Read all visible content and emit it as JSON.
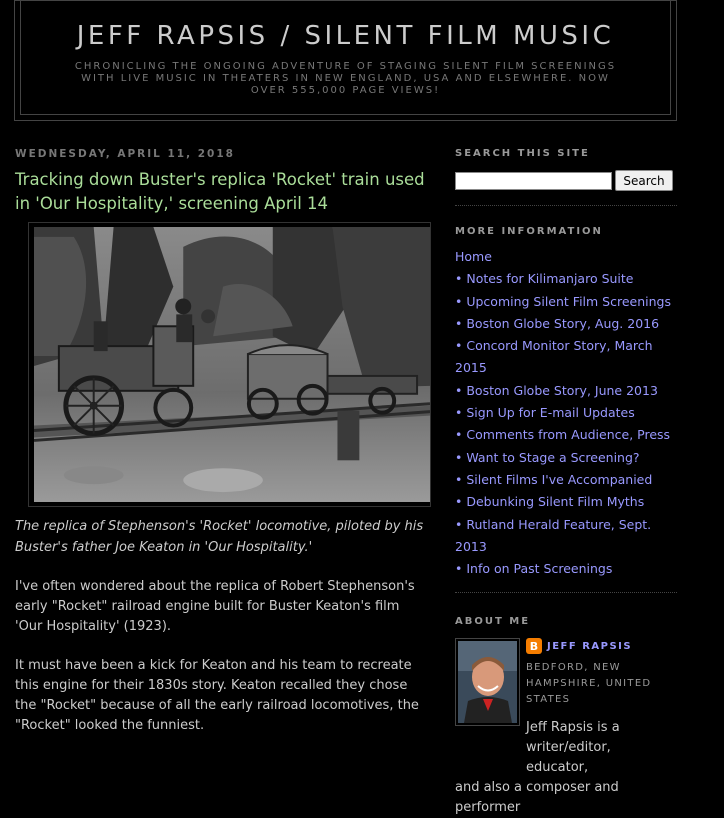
{
  "header": {
    "title": "JEFF RAPSIS / SILENT FILM MUSIC",
    "description": "CHRONICLING THE ONGOING ADVENTURE OF STAGING SILENT FILM SCREENINGS WITH LIVE MUSIC IN THEATERS IN NEW ENGLAND, USA AND ELSEWHERE. NOW OVER 555,000 PAGE VIEWS!"
  },
  "post": {
    "date": "WEDNESDAY, APRIL 11, 2018",
    "title": "Tracking down Buster's replica 'Rocket' train used in 'Our Hospitality,' screening April 14",
    "caption": "The replica of Stephenson's 'Rocket' locomotive, piloted by his Buster's father Joe Keaton in 'Our Hospitality.'",
    "paragraphs": [
      "I've often wondered about the replica of Robert Stephenson's early \"Rocket\" railroad engine built for Buster Keaton's film 'Our Hospitality' (1923).",
      "It must have been a kick for Keaton and his team to recreate this engine for their 1830s story. Keaton recalled they chose the \"Rocket\" because of all the early railroad locomotives, the \"Rocket\" looked the funniest."
    ]
  },
  "sidebar": {
    "search_heading": "SEARCH THIS SITE",
    "search_value": "",
    "search_button": "Search",
    "more_heading": "MORE INFORMATION",
    "links": [
      "Home",
      "• Notes for Kilimanjaro Suite",
      "• Upcoming Silent Film Screenings",
      "• Boston Globe Story, Aug. 2016",
      "• Concord Monitor Story, March 2015",
      "• Boston Globe Story, June 2013",
      "• Sign Up for E-mail Updates",
      "• Comments from Audience, Press",
      "• Want to Stage a Screening?",
      "• Silent Films I've Accompanied",
      "• Debunking Silent Film Myths",
      "• Rutland Herald Feature, Sept. 2013",
      "• Info on Past Screenings"
    ],
    "about_heading": "ABOUT ME",
    "profile_icon": "blogger-icon",
    "profile_name": "JEFF RAPSIS",
    "profile_location": "BEDFORD, NEW HAMPSHIRE, UNITED STATES",
    "profile_bio_1": "Jeff Rapsis is a writer/editor, educator,",
    "profile_bio_2": "and also a composer and performer"
  },
  "colors": {
    "background": "#000000",
    "post_title": "#aadd99",
    "link": "#9999ff",
    "blogger_orange": "#f57d00"
  }
}
